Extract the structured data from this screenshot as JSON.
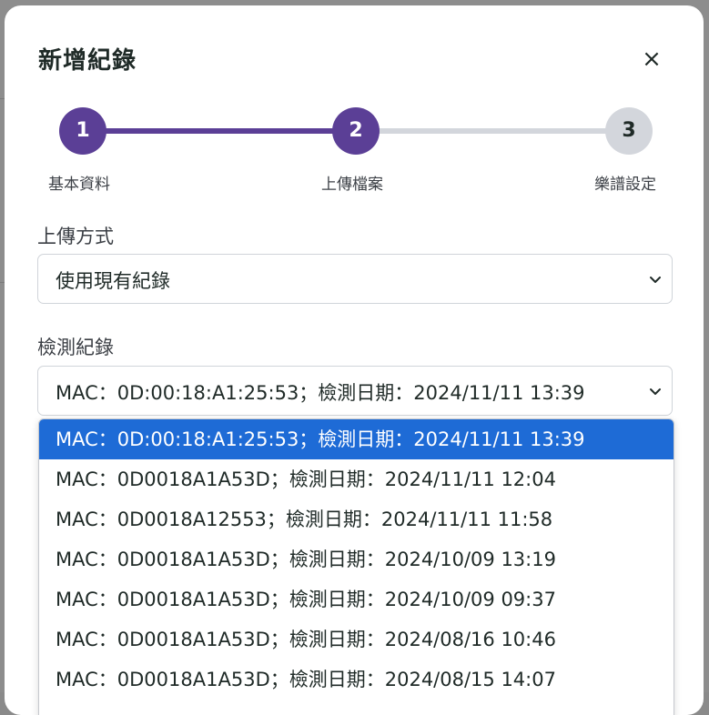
{
  "modal": {
    "title": "新增紀錄",
    "close_label": "×"
  },
  "stepper": {
    "steps": [
      {
        "number": "1",
        "label": "基本資料",
        "state": "completed"
      },
      {
        "number": "2",
        "label": "上傳檔案",
        "state": "active"
      },
      {
        "number": "3",
        "label": "樂譜設定",
        "state": "inactive"
      }
    ]
  },
  "upload_method": {
    "label": "上傳方式",
    "selected": "使用現有紀錄"
  },
  "record": {
    "label": "檢測紀錄",
    "selected": "MAC：0D:00:18:A1:25:53；檢測日期：2024/11/11 13:39",
    "options": [
      "MAC：0D:00:18:A1:25:53；檢測日期：2024/11/11 13:39",
      "MAC：0D0018A1A53D；檢測日期：2024/11/11 12:04",
      "MAC：0D0018A12553；檢測日期：2024/11/11 11:58",
      "MAC：0D0018A1A53D；檢測日期：2024/10/09 13:19",
      "MAC：0D0018A1A53D；檢測日期：2024/10/09 09:37",
      "MAC：0D0018A1A53D；檢測日期：2024/08/16 10:46",
      "MAC：0D0018A1A53D；檢測日期：2024/08/15 14:07"
    ]
  },
  "colors": {
    "accent": "#5b3f96",
    "inactive_step": "#d3d6dc",
    "option_highlight": "#1e6bd6"
  }
}
